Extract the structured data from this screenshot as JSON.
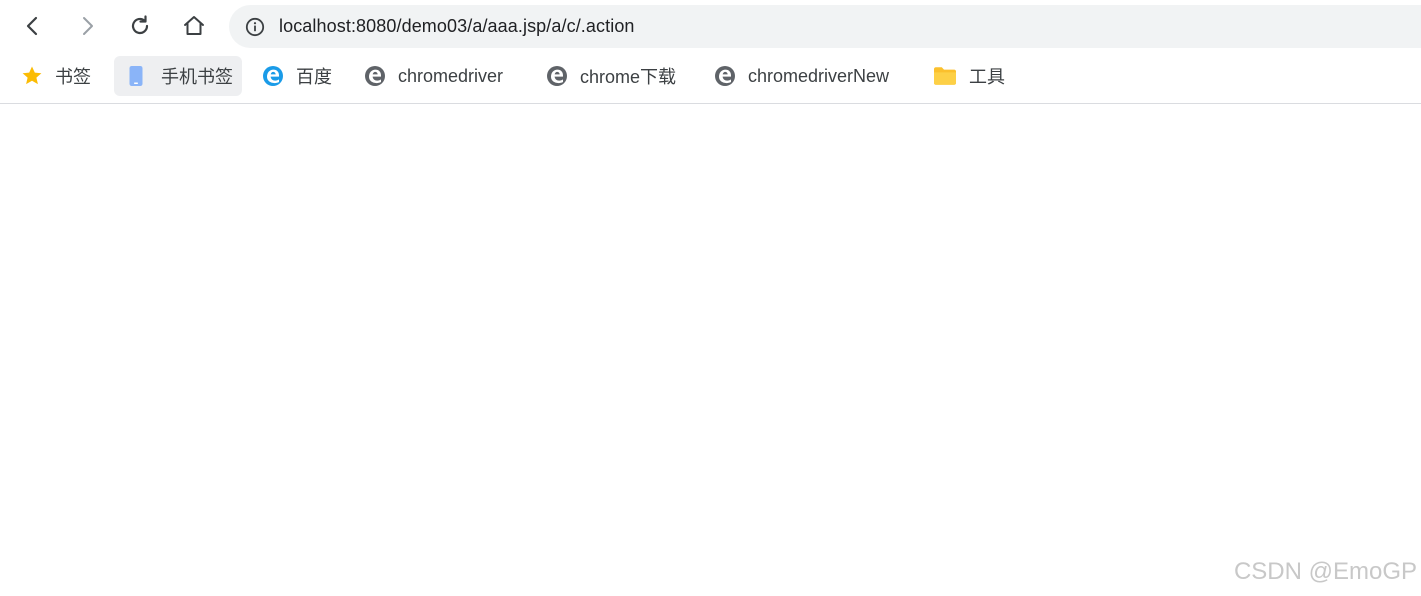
{
  "toolbar": {
    "back_icon": "chevron-left-icon",
    "forward_icon": "chevron-right-icon",
    "reload_icon": "reload-icon",
    "home_icon": "home-icon"
  },
  "address_bar": {
    "info_icon": "info-icon",
    "url": "localhost:8080/demo03/a/aaa.jsp/a/c/.action"
  },
  "bookmarks": [
    {
      "label": "书签",
      "icon": "star-icon",
      "color": "#fbbc04"
    },
    {
      "label": "手机书签",
      "icon": "phone-icon",
      "color": "#8ab4f8"
    },
    {
      "label": "百度",
      "icon": "edge-icon",
      "color": "#1a9be8"
    },
    {
      "label": "chromedriver",
      "icon": "edge-icon",
      "color": "#5f6368"
    },
    {
      "label": "chrome下载",
      "icon": "edge-icon",
      "color": "#5f6368"
    },
    {
      "label": "chromedriverNew",
      "icon": "edge-icon",
      "color": "#5f6368"
    },
    {
      "label": "工具",
      "icon": "folder-icon",
      "color": "#fbc02d"
    }
  ],
  "watermark": "CSDN @EmoGP"
}
